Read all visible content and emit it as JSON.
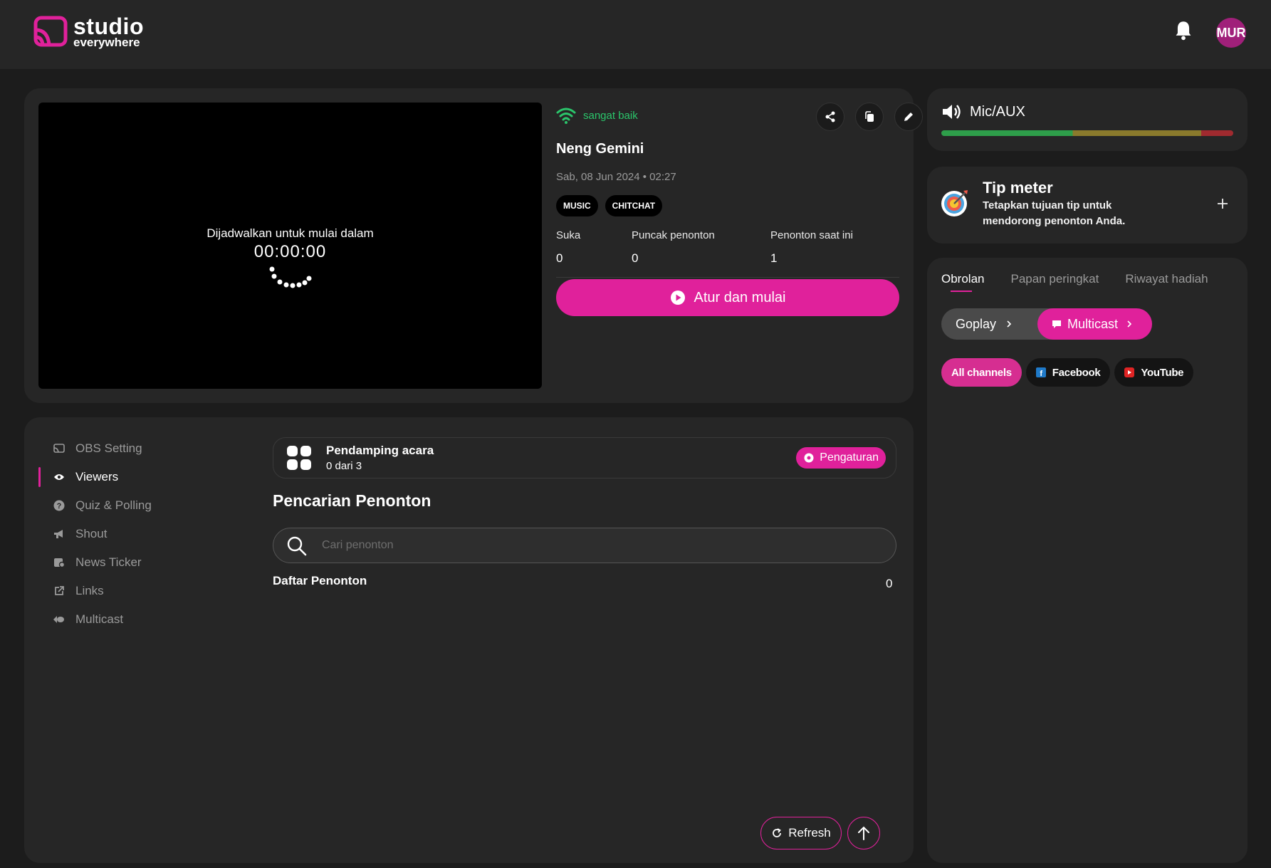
{
  "header": {
    "logo_main": "studio",
    "logo_sub": "everywhere",
    "avatar_initials": "MUR",
    "brand_color": "#e0219b"
  },
  "preview": {
    "scheduled_label": "Dijadwalkan untuk mulai dalam",
    "timer": "00:00:00"
  },
  "stream": {
    "signal_quality": "sangat baik",
    "title": "Neng Gemini",
    "date": "Sab, 08 Jun 2024 • 02:27",
    "tags": [
      "MUSIC",
      "CHITCHAT"
    ],
    "stats": {
      "likes_label": "Suka",
      "likes_value": "0",
      "peak_label": "Puncak penonton",
      "peak_value": "0",
      "current_label": "Penonton saat ini",
      "current_value": "1"
    },
    "start_button": "Atur dan mulai"
  },
  "side_menu": [
    {
      "label": "OBS Setting",
      "icon": "obs-icon"
    },
    {
      "label": "Viewers",
      "icon": "eye-icon"
    },
    {
      "label": "Quiz & Polling",
      "icon": "question-icon"
    },
    {
      "label": "Shout",
      "icon": "megaphone-icon"
    },
    {
      "label": "News Ticker",
      "icon": "news-icon"
    },
    {
      "label": "Links",
      "icon": "link-icon"
    },
    {
      "label": "Multicast",
      "icon": "multicast-icon"
    }
  ],
  "companion": {
    "title": "Pendamping acara",
    "subtitle": "0 dari 3",
    "settings_button": "Pengaturan"
  },
  "viewer_search": {
    "title": "Pencarian Penonton",
    "placeholder": "Cari penonton",
    "value": "",
    "list_title": "Daftar Penonton",
    "list_count": "0"
  },
  "actions": {
    "refresh": "Refresh"
  },
  "mic": {
    "title": "Mic/AUX"
  },
  "tip_meter": {
    "title": "Tip meter",
    "description_line1": "Tetapkan tujuan tip untuk",
    "description_line2": "mendorong penonton Anda."
  },
  "chat": {
    "tabs": [
      "Obrolan",
      "Papan peringkat",
      "Riwayat hadiah"
    ],
    "platform_gray": "Goplay",
    "platform_pink": "Multicast",
    "channels": [
      "All channels",
      "Facebook",
      "YouTube"
    ]
  }
}
